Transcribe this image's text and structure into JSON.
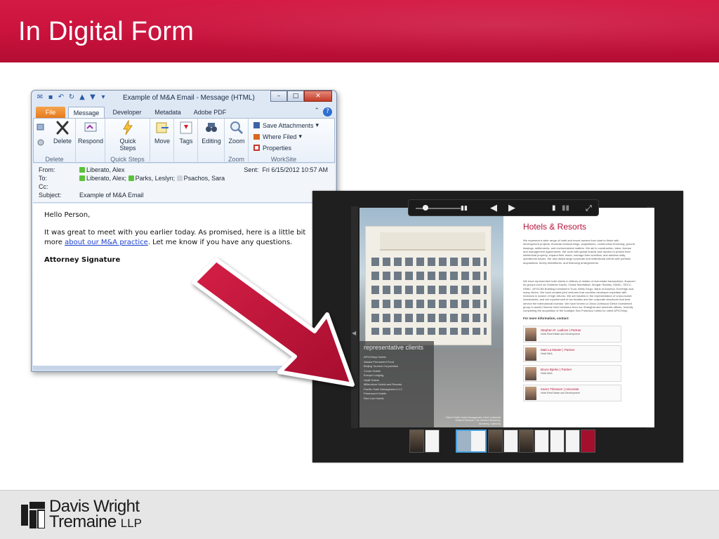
{
  "slide": {
    "title": "In Digital Form",
    "accent_color": "#c8123c"
  },
  "outlook": {
    "window_title": "Example of M&A Email  -  Message (HTML)",
    "tabs": [
      "File",
      "Message",
      "Developer",
      "Metadata",
      "Adobe PDF"
    ],
    "active_tab": "Message",
    "ribbon": {
      "delete_group": "Delete",
      "delete_label": "Delete",
      "respond_label": "Respond",
      "quick_steps_label": "Quick Steps",
      "quick_steps_group": "Quick Steps",
      "move_label": "Move",
      "tags_label": "Tags",
      "editing_label": "Editing",
      "zoom_label": "Zoom",
      "zoom_group": "Zoom",
      "save_attachments": "Save Attachments",
      "where_filed": "Where Filed",
      "properties": "Properties",
      "worksite_group": "WorkSite"
    },
    "header": {
      "from_label": "From:",
      "from_value": "Liberato, Alex",
      "to_label": "To:",
      "to_values": [
        "Liberato, Alex;",
        "Parks, Leslyn;",
        "Psachos, Sara"
      ],
      "cc_label": "Cc:",
      "subject_label": "Subject:",
      "subject_value": "Example of M&A Email",
      "sent_label": "Sent:",
      "sent_value": "Fri 6/15/2012 10:57 AM"
    },
    "body": {
      "greeting": "Hello Person,",
      "text_before_link": "It was great to meet with you earlier today. As promised, here is a little bit more",
      "link_text": "about our M&A practice",
      "text_after_link": ". Let me know if you have any questions.",
      "signature": "Attorney Signature"
    }
  },
  "viewer": {
    "right_page": {
      "title": "Hotels & Resorts",
      "para1": "We represent a wide range of hotel and resort owners from start to finish with development projects, financial restructurings, acquisitions, construction financing, ground leasings, settlements, and environmental matters. We aid in construction, labor, license and management agreements. We work with global brands and owners to protect their intellectual property, expand their reach, manage their workflow, and address daily operational issues. We also assist large corporate and institutional clients with portfolio acquisitions, timely divestitures, and financing arrangements.",
      "para2": "We have represented hotel clients in billions of dollars of real estate transactions, financed by groups such as Goldman Sachs, Chase Manhattan, Morgan Stanley, GMAC, GECC, HSBC, AFS/CIBI Building Investment Trust, Wells Fargo, Bank of America, EverHigh and many others. We have created joint ventures that combine developer expertise with investors in search of high returns. We are leaders in the representation of cross-border investments, and are experienced in tax treaties and the corporate structures that best service the international investor. We have formed a China Lichtwood Direct Investment group to assist Chinese hotel investors from our Shanghai and domestic offices, recently completing the acquisition of the boutique San Francisco hotels for client APIC/Harp.",
      "contact_heading": "For more information, contact:",
      "contacts": [
        {
          "name": "Stephen R. Ladizes",
          "role": "Partner",
          "detail": "Hotel Real Estate and Development"
        },
        {
          "name": "Matt La Master",
          "role": "Partner",
          "detail": "Hotel M&A"
        },
        {
          "name": "Bruce Bjerke",
          "role": "Partner",
          "detail": "Hotel M&A"
        },
        {
          "name": "Karen Thiessen",
          "role": "Associate",
          "detail": "Hotel Real Estate and Development"
        }
      ]
    },
    "left_page": {
      "clients_heading": "representative clients",
      "clients": [
        "APIC/Harp Hotels",
        "Alaska Permanent Fund",
        "Beijing Tourism Corporation",
        "Crown Hotels",
        "Europe Lodging",
        "Hyatt Hotels",
        "Millennium Hotels and Resorts",
        "Pacific Hotel Management LLC",
        "Paramount Hotels",
        "Red Lion Hotels"
      ],
      "photo_caption": "Client: Pacific Hotel Management; InterContinental Hotels & Resorts, The Clement Monterey, Monterey, California"
    }
  },
  "footer": {
    "firm_line1": "Davis Wright",
    "firm_line2": "Tremaine",
    "firm_suffix": "LLP"
  }
}
